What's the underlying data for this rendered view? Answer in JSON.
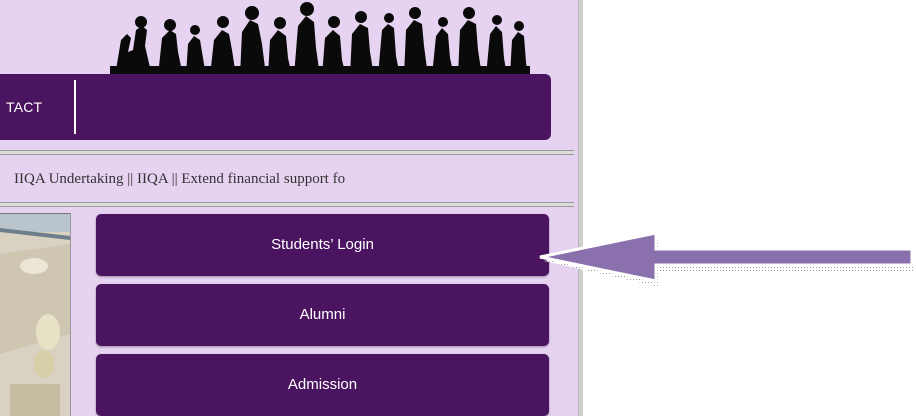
{
  "nav": {
    "contact_label": "TACT"
  },
  "ticker": {
    "text": "IIQA Undertaking  ||   IIQA  ||   Extend financial support fo"
  },
  "menu": {
    "students_login": "Students’ Login",
    "alumni": "Alumni",
    "admission": "Admission"
  },
  "colors": {
    "site_background": "#e6d3f2",
    "brand_purple": "#4b1460",
    "arrow_fill": "#8a70ad"
  }
}
